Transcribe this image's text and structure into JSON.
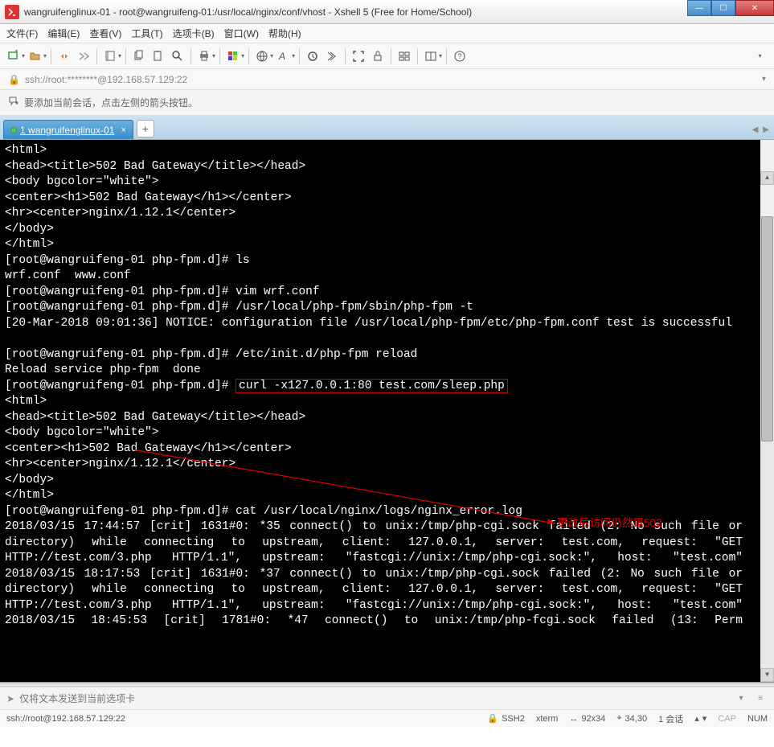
{
  "window": {
    "title": "wangruifenglinux-01 - root@wangruifeng-01:/usr/local/nginx/conf/vhost - Xshell 5 (Free for Home/School)"
  },
  "menu": {
    "file": "文件(F)",
    "edit": "编辑(E)",
    "view": "查看(V)",
    "tools": "工具(T)",
    "tabs": "选项卡(B)",
    "window": "窗口(W)",
    "help": "帮助(H)"
  },
  "addressbar": {
    "text": "ssh://root:********@192.168.57.129:22"
  },
  "infobar": {
    "text": "要添加当前会话，点击左侧的箭头按钮。"
  },
  "tabs": {
    "active": {
      "index": "1",
      "label": "wangruifenglinux-01"
    }
  },
  "sendbar": {
    "placeholder": "仅将文本发送到当前选项卡"
  },
  "statusbar": {
    "connection": "ssh://root@192.168.57.129:22",
    "ssh": "SSH2",
    "term": "xterm",
    "size": "92x34",
    "cursor": "34,30",
    "sessions": "1 会话",
    "caps": "CAP",
    "num": "NUM"
  },
  "annotation": {
    "text": "更改后访问仍然是502"
  },
  "highlight": {
    "cmd": "curl -x127.0.0.1:80 test.com/sleep.php"
  },
  "terminal": {
    "l01": "<html>",
    "l02": "<head><title>502 Bad Gateway</title></head>",
    "l03": "<body bgcolor=\"white\">",
    "l04": "<center><h1>502 Bad Gateway</h1></center>",
    "l05": "<hr><center>nginx/1.12.1</center>",
    "l06": "</body>",
    "l07": "</html>",
    "l08": "[root@wangruifeng-01 php-fpm.d]# ls",
    "l09": "wrf.conf  www.conf",
    "l10": "[root@wangruifeng-01 php-fpm.d]# vim wrf.conf",
    "l11": "[root@wangruifeng-01 php-fpm.d]# /usr/local/php-fpm/sbin/php-fpm -t",
    "l12": "[20-Mar-2018 09:01:36] NOTICE: configuration file /usr/local/php-fpm/etc/php-fpm.conf test is successful",
    "l14": "[root@wangruifeng-01 php-fpm.d]# /etc/init.d/php-fpm reload",
    "l15": "Reload service php-fpm  done",
    "l16a": "[root@wangruifeng-01 php-fpm.d]# ",
    "l17": "<html>",
    "l18": "<head><title>502 Bad Gateway</title></head>",
    "l19": "<body bgcolor=\"white\">",
    "l20": "<center><h1>502 Bad Gateway</h1></center>",
    "l21": "<hr><center>nginx/1.12.1</center>",
    "l22": "</body>",
    "l23": "</html>",
    "l24": "[root@wangruifeng-01 php-fpm.d]# cat /usr/local/nginx/logs/nginx_error.log",
    "l25": "2018/03/15 17:44:57 [crit] 1631#0: *35 connect() to unix:/tmp/php-cgi.sock failed (2: No such file or directory) while connecting to upstream, client: 127.0.0.1, server: test.com, request: \"GET HTTP://test.com/3.php HTTP/1.1\", upstream: \"fastcgi://unix:/tmp/php-cgi.sock:\", host: \"test.com\"",
    "l26": "2018/03/15 18:17:53 [crit] 1631#0: *37 connect() to unix:/tmp/php-cgi.sock failed (2: No such file or directory) while connecting to upstream, client: 127.0.0.1, server: test.com, request: \"GET HTTP://test.com/3.php HTTP/1.1\", upstream: \"fastcgi://unix:/tmp/php-cgi.sock:\", host: \"test.com\"",
    "l27": "2018/03/15 18:45:53 [crit] 1781#0: *47 connect() to unix:/tmp/php-fcgi.sock failed (13: Perm"
  }
}
